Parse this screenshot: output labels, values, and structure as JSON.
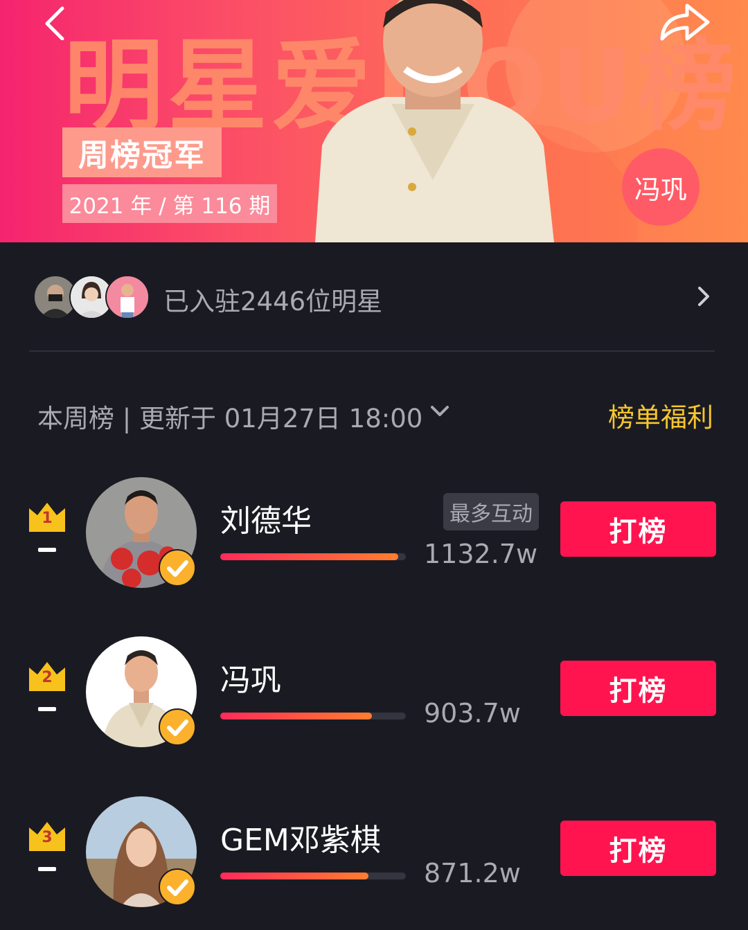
{
  "banner": {
    "title": "明星爱DOU榜",
    "champion_tag": "周榜冠军",
    "period": "2021 年 / 第 116 期",
    "featured_name": "冯巩"
  },
  "joined": {
    "text": "已入驻2446位明星",
    "avatars": [
      "avatar-1",
      "avatar-2",
      "avatar-3"
    ]
  },
  "board": {
    "title": "本周榜 | 更新于 01月27日 18:00",
    "benefit_label": "榜单福利"
  },
  "ranking": [
    {
      "rank": "1",
      "name": "刘德华",
      "badge": "最多互动",
      "score": "1132.7w",
      "progress": 1.0,
      "button": "打榜"
    },
    {
      "rank": "2",
      "name": "冯巩",
      "badge": "",
      "score": "903.7w",
      "progress": 0.85,
      "button": "打榜"
    },
    {
      "rank": "3",
      "name": "GEM邓紫棋",
      "badge": "",
      "score": "871.2w",
      "progress": 0.83,
      "button": "打榜"
    }
  ],
  "colors": {
    "background": "#1a1b22",
    "accent_red": "#ff1450",
    "accent_gold": "#f7c62f",
    "muted_text": "#a9aab2"
  }
}
